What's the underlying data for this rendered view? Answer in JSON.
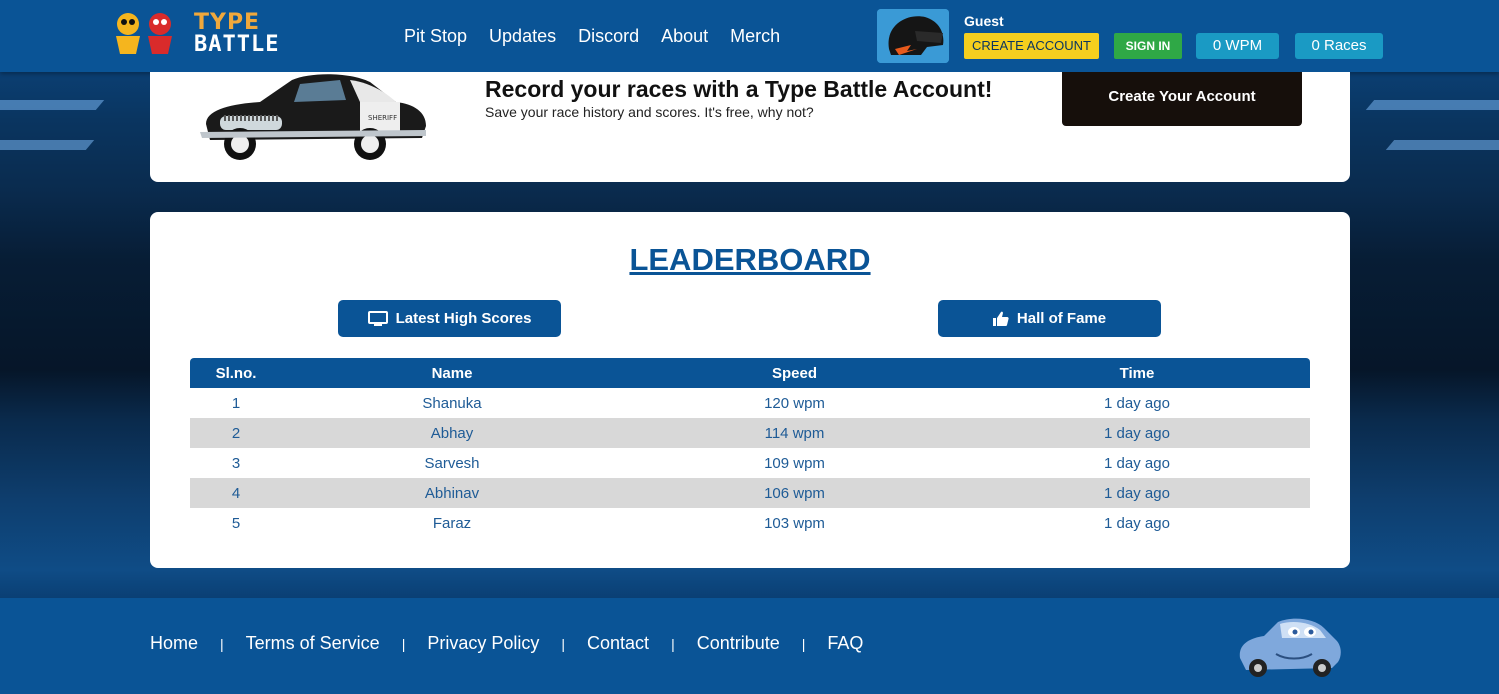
{
  "header": {
    "logo_line1": "TYPE",
    "logo_line2": "BATTLE",
    "nav": [
      "Pit Stop",
      "Updates",
      "Discord",
      "About",
      "Merch"
    ],
    "user_name": "Guest",
    "create_account_label": "CREATE ACCOUNT",
    "sign_in_label": "SIGN IN",
    "wpm": "0 WPM",
    "races": "0 Races"
  },
  "promo": {
    "title": "Record your races with a Type Battle Account!",
    "subtitle": "Save your race history and scores. It's free, why not?",
    "button_label": "Create Your Account",
    "car_badge": "SHERIFF"
  },
  "leaderboard": {
    "title": "LEADERBOARD",
    "tab_latest": "Latest High Scores",
    "tab_hall": "Hall of Fame",
    "columns": [
      "Sl.no.",
      "Name",
      "Speed",
      "Time"
    ],
    "rows": [
      [
        "1",
        "Shanuka",
        "120 wpm",
        "1 day ago"
      ],
      [
        "2",
        "Abhay",
        "114 wpm",
        "1 day ago"
      ],
      [
        "3",
        "Sarvesh",
        "109 wpm",
        "1 day ago"
      ],
      [
        "4",
        "Abhinav",
        "106 wpm",
        "1 day ago"
      ],
      [
        "5",
        "Faraz",
        "103 wpm",
        "1 day ago"
      ]
    ]
  },
  "footer": {
    "links": [
      "Home",
      "Terms of Service",
      "Privacy Policy",
      "Contact",
      "Contribute",
      "FAQ"
    ],
    "separator": "|"
  },
  "colors": {
    "primary": "#0a5496",
    "create_account": "#f5cf1e",
    "sign_in": "#2fa846",
    "pill": "#1a9ac4",
    "promo_button": "#160f0b"
  }
}
